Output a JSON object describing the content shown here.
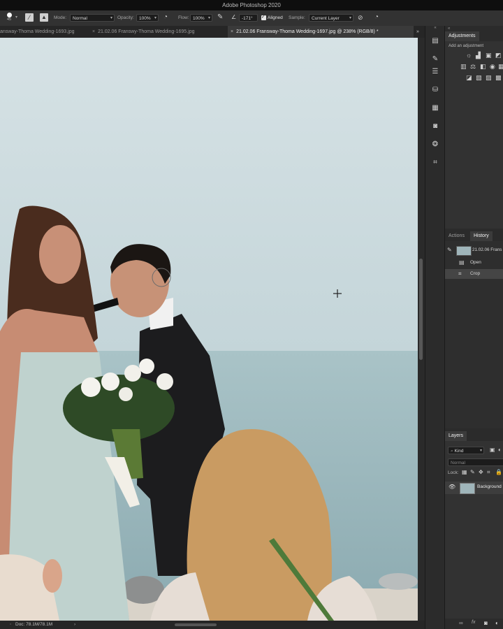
{
  "app": {
    "title": "Adobe Photoshop 2020"
  },
  "options_bar": {
    "brush_size": "45",
    "mode_label": "Mode:",
    "mode_value": "Normal",
    "opacity_label": "Opacity:",
    "opacity_value": "100%",
    "flow_label": "Flow:",
    "flow_value": "100%",
    "angle_value": "-171°",
    "aligned_label": "Aligned",
    "aligned_checked": true,
    "sample_label": "Sample:",
    "sample_value": "Current Layer"
  },
  "tabs": [
    {
      "label": "answay-Thoma Wedding-1693.jpg",
      "active": false
    },
    {
      "label": "21.02.06 Franswy-Thoma Wedding-1695.jpg",
      "active": false
    },
    {
      "label": "21.02.06 Fransway-Thoma Wedding-1697.jpg @ 238% (RGB/8) *",
      "active": true
    }
  ],
  "tab_close_glyph": "×",
  "tab_overflow_glyph": "»",
  "status": {
    "doc_info": "Doc: 78.1M/78.1M"
  },
  "adjustments_panel": {
    "tab_label": "Adjustments",
    "hint": "Add an adjustment"
  },
  "history_panel": {
    "tabs": [
      "Actions",
      "History"
    ],
    "snapshot_label": "21.02.06 Frans",
    "steps": [
      {
        "label": "Open",
        "selected": false
      },
      {
        "label": "Crop",
        "selected": true
      }
    ]
  },
  "layers_panel": {
    "tab_label": "Layers",
    "filter_kind": "Kind",
    "blend_mode": "Normal",
    "lock_label": "Lock:",
    "layer_name": "Background"
  },
  "colors": {
    "sky": "#c9d9dc",
    "sea": "#9fb9bd",
    "dress": "#bfd2ce",
    "suit": "#1c1c1e",
    "hair_bride": "#4a2c1e",
    "hair_guest": "#c99b62"
  }
}
